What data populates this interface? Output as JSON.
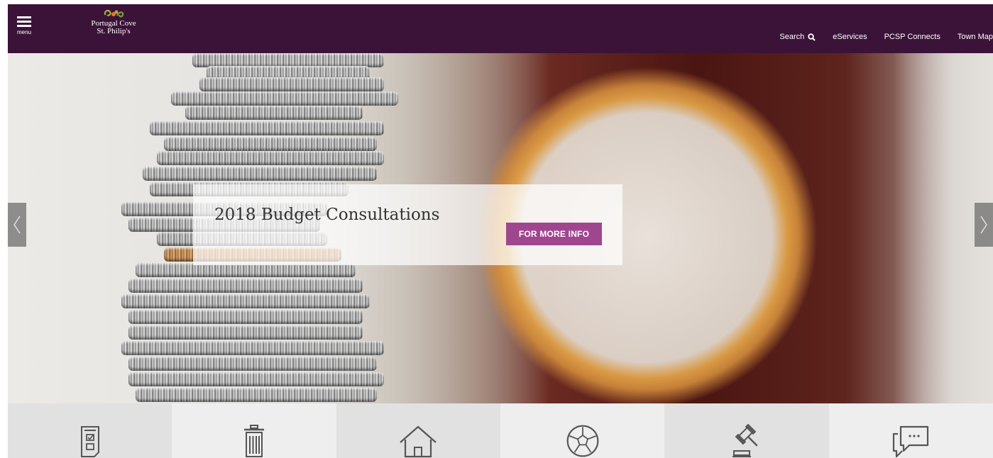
{
  "header": {
    "menu_label": "menu",
    "logo": {
      "line1": "Portugal Cove",
      "line2": "St. Philip's"
    },
    "nav": [
      {
        "label": "Search",
        "icon": "search-icon"
      },
      {
        "label": "eServices"
      },
      {
        "label": "PCSP Connects"
      },
      {
        "label": "Town Map"
      }
    ]
  },
  "hero": {
    "title": "2018 Budget Consultations",
    "button_label": "FOR MORE INFO",
    "prev_icon": "chevron-left-icon",
    "next_icon": "chevron-right-icon"
  },
  "quick_links": [
    {
      "icon": "form-checklist-icon"
    },
    {
      "icon": "trash-can-icon"
    },
    {
      "icon": "house-icon"
    },
    {
      "icon": "soccer-ball-icon"
    },
    {
      "icon": "gavel-icon"
    },
    {
      "icon": "chat-bubble-icon"
    }
  ],
  "colors": {
    "header_bg": "#3b1338",
    "button_bg": "#a0468f",
    "tile_dark": "#e1e1e1",
    "tile_light": "#eeeeee",
    "icon_stroke": "#555555"
  }
}
